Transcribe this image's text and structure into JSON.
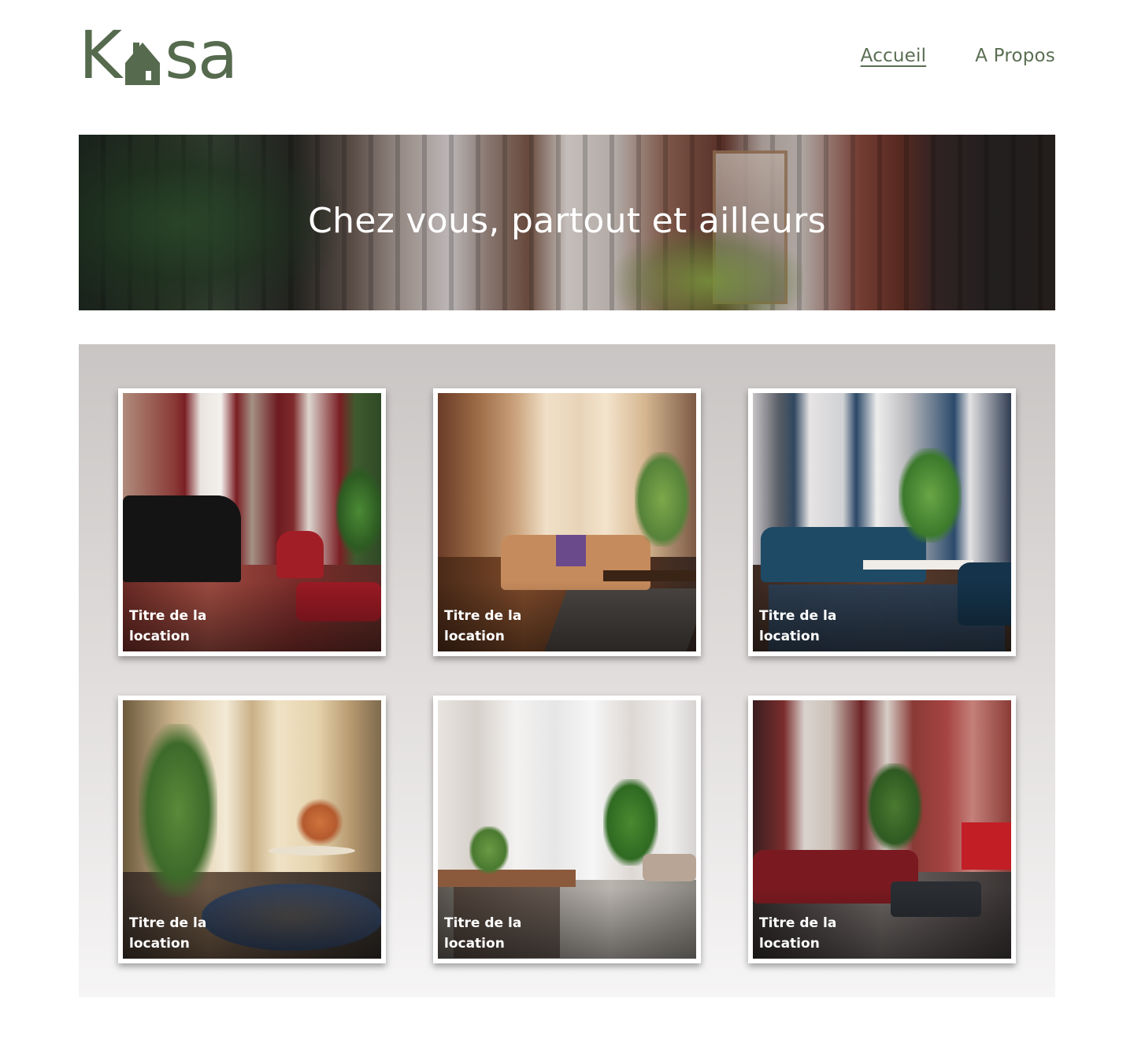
{
  "header": {
    "logo_text": "Kasa",
    "logo_color": "#566b4e",
    "nav": [
      {
        "label": "Accueil",
        "active": true
      },
      {
        "label": "A Propos",
        "active": false
      }
    ]
  },
  "banner": {
    "title": "Chez vous, partout et ailleurs"
  },
  "gallery": {
    "cards": [
      {
        "title": "Titre de la location"
      },
      {
        "title": "Titre de la location"
      },
      {
        "title": "Titre de la location"
      },
      {
        "title": "Titre de la location"
      },
      {
        "title": "Titre de la location"
      },
      {
        "title": "Titre de la location"
      }
    ]
  }
}
